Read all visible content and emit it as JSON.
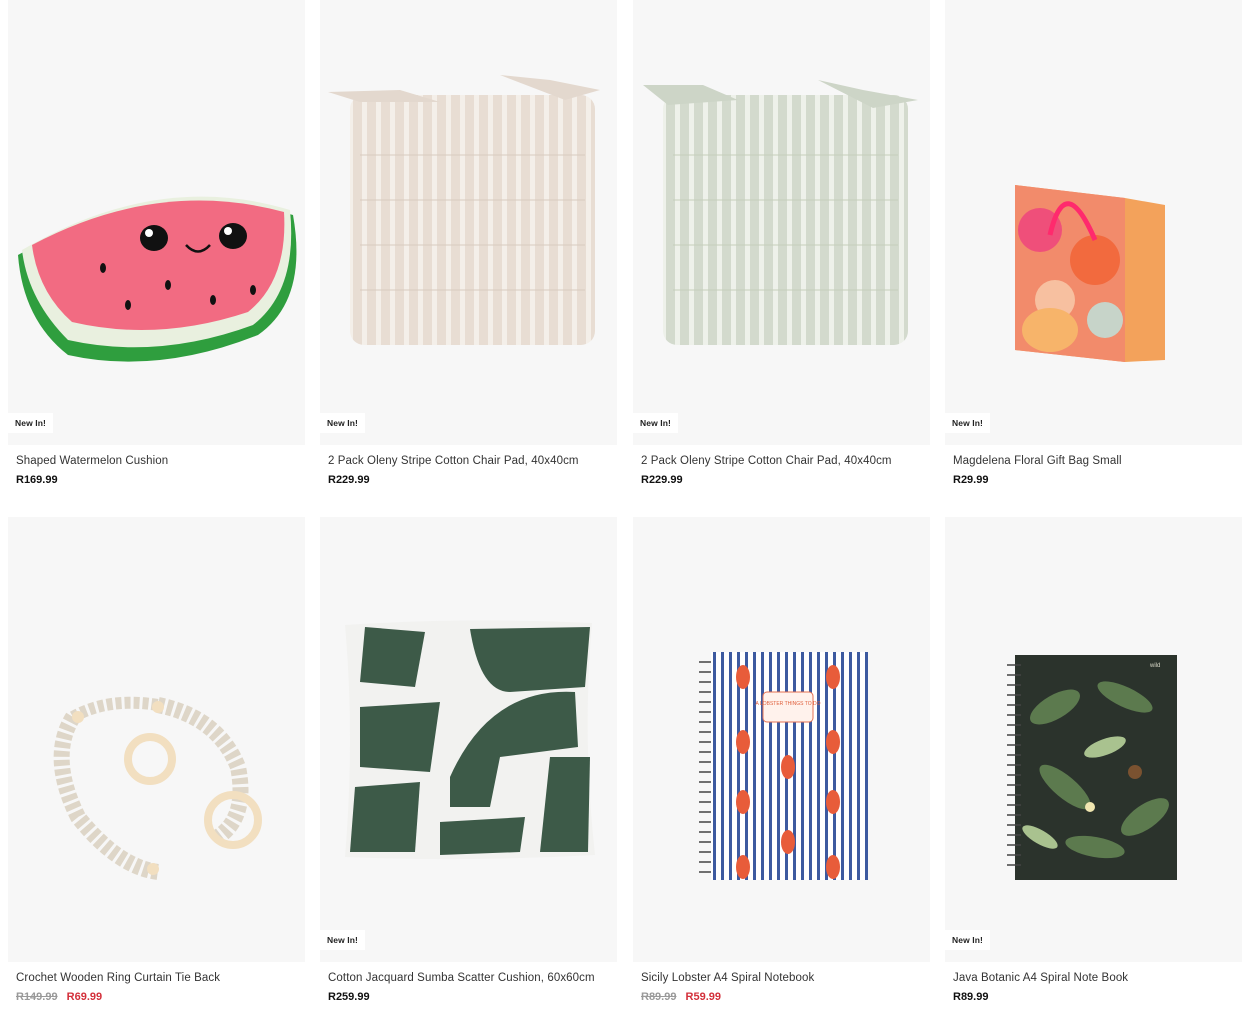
{
  "products": [
    {
      "name": "Shaped Watermelon Cushion",
      "price": "R169.99",
      "badge": "New In!"
    },
    {
      "name": "2 Pack Oleny Stripe Cotton Chair Pad, 40x40cm",
      "price": "R229.99",
      "badge": "New In!"
    },
    {
      "name": "2 Pack Oleny Stripe Cotton Chair Pad, 40x40cm",
      "price": "R229.99",
      "badge": "New In!"
    },
    {
      "name": "Magdelena Floral Gift Bag Small",
      "price": "R29.99",
      "badge": "New In!"
    },
    {
      "name": "Crochet Wooden Ring Curtain Tie Back",
      "old_price": "R149.99",
      "sale_price": "R69.99"
    },
    {
      "name": "Cotton Jacquard Sumba Scatter Cushion, 60x60cm",
      "price": "R259.99",
      "badge": "New In!"
    },
    {
      "name": "Sicily Lobster A4 Spiral Notebook",
      "old_price": "R89.99",
      "sale_price": "R59.99"
    },
    {
      "name": "Java Botanic A4 Spiral Note Book",
      "price": "R89.99",
      "badge": "New In!"
    }
  ],
  "notebook_cover_text": "A LOBSTER THINGS TO DO",
  "notebook2_cover_text": "wild",
  "colors": {
    "sale": "#d32f3a",
    "image_bg": "#f7f7f7"
  }
}
